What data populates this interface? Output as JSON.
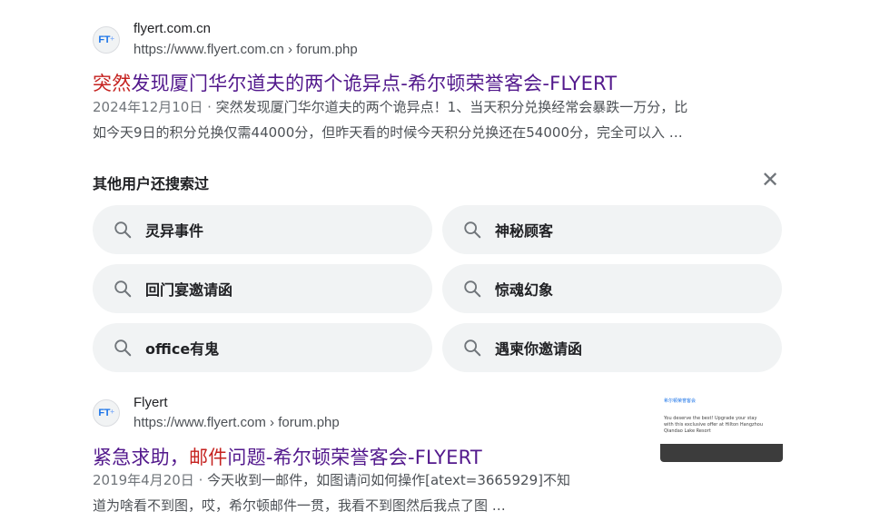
{
  "results": [
    {
      "favicon_text": "FT",
      "site_name": "flyert.com.cn",
      "url": "https://www.flyert.com.cn › forum.php",
      "title_highlight": "突然",
      "title_rest": "发现厦门华尔道夫的两个诡异点-希尔顿荣誉客会-FLYERT",
      "date": "2024年12月10日",
      "separator": " · ",
      "snippet_line1": "突然发现厦门华尔道夫的两个诡异点！1、当天积分兑换经常会暴跌一万分，比",
      "snippet_line2": "如今天9日的积分兑换仅需44000分，但昨天看的时候今天积分兑换还在54000分，完全可以入 …"
    },
    {
      "favicon_text": "FT",
      "site_name": "Flyert",
      "url": "https://www.flyert.com › forum.php",
      "title_part1": "紧急求助，",
      "title_highlight": "邮件",
      "title_part2": "问题-希尔顿荣誉客会-FLYERT",
      "date": "2019年4月20日",
      "separator": " · ",
      "snippet_line1": "今天收到一邮件，如图请问如何操作[atext=3665929]不知",
      "snippet_line2": "道为啥看不到图，哎，希尔顿邮件一贯，我看不到图然后我点了图 …",
      "thumbnail_heading": "希尔顿荣誉客会",
      "thumbnail_text": "You deserve the best! Upgrade your stay with this exclusive offer at Hilton Hangzhou Qiandao Lake Resort"
    }
  ],
  "people_also_search": {
    "title": "其他用户还搜索过",
    "close_icon": "close-icon",
    "items": [
      "灵异事件",
      "神秘顾客",
      "回门宴邀请函",
      "惊魂幻象",
      "office有鬼",
      "遇柬你邀请函"
    ]
  },
  "colors": {
    "highlight": "#c5221f",
    "visited_link": "#52188c",
    "chip_bg": "#f1f3f4"
  }
}
